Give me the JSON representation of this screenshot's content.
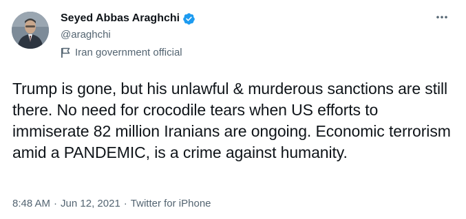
{
  "author": {
    "display_name": "Seyed Abbas Araghchi",
    "handle": "@araghchi",
    "label": "Iran government official",
    "verified": true
  },
  "tweet": {
    "text": "Trump is gone, but his unlawful & murderous sanctions are still there. No need for crocodile tears when US efforts to immiserate 82 million Iranians are ongoing. Economic terrorism amid a PANDEMIC, is a crime against humanity."
  },
  "meta": {
    "time": "8:48 AM",
    "separator": "·",
    "date": "Jun 12, 2021",
    "source": "Twitter for iPhone"
  },
  "icons": {
    "verified": "verified-badge-icon",
    "label": "flag-icon",
    "more": "more-options-icon"
  },
  "colors": {
    "primary_text": "#0f1419",
    "secondary_text": "#536471",
    "verified_blue": "#1d9bf0"
  }
}
